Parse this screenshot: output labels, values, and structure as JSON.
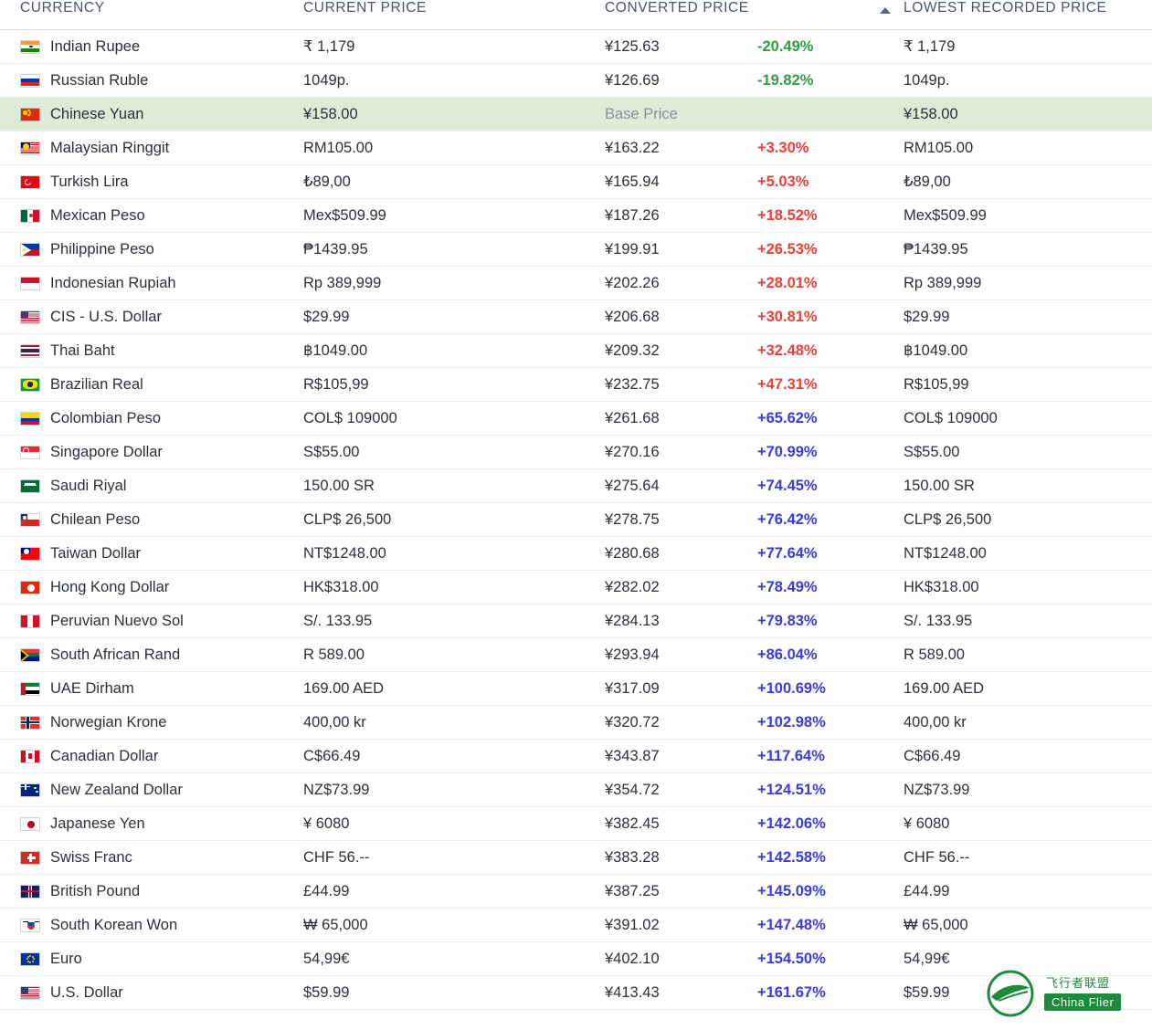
{
  "table": {
    "columns": [
      {
        "key": "currency",
        "label": "CURRENCY"
      },
      {
        "key": "current_price",
        "label": "CURRENT PRICE"
      },
      {
        "key": "converted_price",
        "label": "CONVERTED PRICE"
      },
      {
        "key": "change",
        "label": ""
      },
      {
        "key": "lowest_recorded_price",
        "label": "LOWEST RECORDED PRICE"
      }
    ],
    "sorted_column": "CONVERTED PRICE",
    "sort_direction": "ascending",
    "sort_icon": "triangle-up-icon",
    "base_price_label": "Base Price",
    "colors": {
      "negative": "#2f9e44",
      "positive_red": "#e8413a",
      "positive_blue": "#3b3bd6",
      "base_row_background": "#dcecd7",
      "header_text": "#4a5568"
    },
    "rows": [
      {
        "flag": "flag-india-icon",
        "currency": "Indian Rupee",
        "current": "₹ 1,179",
        "converted": "¥125.63",
        "change": "-20.49%",
        "change_kind": "neg",
        "lowest": "₹ 1,179"
      },
      {
        "flag": "flag-russia-icon",
        "currency": "Russian Ruble",
        "current": "1049р.",
        "converted": "¥126.69",
        "change": "-19.82%",
        "change_kind": "neg",
        "lowest": "1049р."
      },
      {
        "flag": "flag-china-icon",
        "currency": "Chinese Yuan",
        "current": "¥158.00",
        "converted": "Base Price",
        "change": "",
        "change_kind": "base",
        "lowest": "¥158.00"
      },
      {
        "flag": "flag-malaysia-icon",
        "currency": "Malaysian Ringgit",
        "current": "RM105.00",
        "converted": "¥163.22",
        "change": "+3.30%",
        "change_kind": "pos-red",
        "lowest": "RM105.00"
      },
      {
        "flag": "flag-turkey-icon",
        "currency": "Turkish Lira",
        "current": "₺89,00",
        "converted": "¥165.94",
        "change": "+5.03%",
        "change_kind": "pos-red",
        "lowest": "₺89,00"
      },
      {
        "flag": "flag-mexico-icon",
        "currency": "Mexican Peso",
        "current": "Mex$509.99",
        "converted": "¥187.26",
        "change": "+18.52%",
        "change_kind": "pos-red",
        "lowest": "Mex$509.99"
      },
      {
        "flag": "flag-philippines-icon",
        "currency": "Philippine Peso",
        "current": "₱1439.95",
        "converted": "¥199.91",
        "change": "+26.53%",
        "change_kind": "pos-red",
        "lowest": "₱1439.95"
      },
      {
        "flag": "flag-indonesia-icon",
        "currency": "Indonesian Rupiah",
        "current": "Rp 389,999",
        "converted": "¥202.26",
        "change": "+28.01%",
        "change_kind": "pos-red",
        "lowest": "Rp 389,999"
      },
      {
        "flag": "flag-cis-icon",
        "currency": "CIS - U.S. Dollar",
        "current": "$29.99",
        "converted": "¥206.68",
        "change": "+30.81%",
        "change_kind": "pos-red",
        "lowest": "$29.99"
      },
      {
        "flag": "flag-thailand-icon",
        "currency": "Thai Baht",
        "current": "฿1049.00",
        "converted": "¥209.32",
        "change": "+32.48%",
        "change_kind": "pos-red",
        "lowest": "฿1049.00"
      },
      {
        "flag": "flag-brazil-icon",
        "currency": "Brazilian Real",
        "current": "R$105,99",
        "converted": "¥232.75",
        "change": "+47.31%",
        "change_kind": "pos-red",
        "lowest": "R$105,99"
      },
      {
        "flag": "flag-colombia-icon",
        "currency": "Colombian Peso",
        "current": "COL$ 109000",
        "converted": "¥261.68",
        "change": "+65.62%",
        "change_kind": "pos-blue",
        "lowest": "COL$ 109000"
      },
      {
        "flag": "flag-singapore-icon",
        "currency": "Singapore Dollar",
        "current": "S$55.00",
        "converted": "¥270.16",
        "change": "+70.99%",
        "change_kind": "pos-blue",
        "lowest": "S$55.00"
      },
      {
        "flag": "flag-saudi-arabia-icon",
        "currency": "Saudi Riyal",
        "current": "150.00 SR",
        "converted": "¥275.64",
        "change": "+74.45%",
        "change_kind": "pos-blue",
        "lowest": "150.00 SR"
      },
      {
        "flag": "flag-chile-icon",
        "currency": "Chilean Peso",
        "current": "CLP$ 26,500",
        "converted": "¥278.75",
        "change": "+76.42%",
        "change_kind": "pos-blue",
        "lowest": "CLP$ 26,500"
      },
      {
        "flag": "flag-taiwan-icon",
        "currency": "Taiwan Dollar",
        "current": "NT$1248.00",
        "converted": "¥280.68",
        "change": "+77.64%",
        "change_kind": "pos-blue",
        "lowest": "NT$1248.00"
      },
      {
        "flag": "flag-hong-kong-icon",
        "currency": "Hong Kong Dollar",
        "current": "HK$318.00",
        "converted": "¥282.02",
        "change": "+78.49%",
        "change_kind": "pos-blue",
        "lowest": "HK$318.00"
      },
      {
        "flag": "flag-peru-icon",
        "currency": "Peruvian Nuevo Sol",
        "current": "S/. 133.95",
        "converted": "¥284.13",
        "change": "+79.83%",
        "change_kind": "pos-blue",
        "lowest": "S/. 133.95"
      },
      {
        "flag": "flag-south-africa-icon",
        "currency": "South African Rand",
        "current": "R 589.00",
        "converted": "¥293.94",
        "change": "+86.04%",
        "change_kind": "pos-blue",
        "lowest": "R 589.00"
      },
      {
        "flag": "flag-uae-icon",
        "currency": "UAE Dirham",
        "current": "169.00 AED",
        "converted": "¥317.09",
        "change": "+100.69%",
        "change_kind": "pos-blue",
        "lowest": "169.00 AED"
      },
      {
        "flag": "flag-norway-icon",
        "currency": "Norwegian Krone",
        "current": "400,00 kr",
        "converted": "¥320.72",
        "change": "+102.98%",
        "change_kind": "pos-blue",
        "lowest": "400,00 kr"
      },
      {
        "flag": "flag-canada-icon",
        "currency": "Canadian Dollar",
        "current": "C$66.49",
        "converted": "¥343.87",
        "change": "+117.64%",
        "change_kind": "pos-blue",
        "lowest": "C$66.49"
      },
      {
        "flag": "flag-new-zealand-icon",
        "currency": "New Zealand Dollar",
        "current": "NZ$73.99",
        "converted": "¥354.72",
        "change": "+124.51%",
        "change_kind": "pos-blue",
        "lowest": "NZ$73.99"
      },
      {
        "flag": "flag-japan-icon",
        "currency": "Japanese Yen",
        "current": "¥ 6080",
        "converted": "¥382.45",
        "change": "+142.06%",
        "change_kind": "pos-blue",
        "lowest": "¥ 6080"
      },
      {
        "flag": "flag-switzerland-icon",
        "currency": "Swiss Franc",
        "current": "CHF 56.--",
        "converted": "¥383.28",
        "change": "+142.58%",
        "change_kind": "pos-blue",
        "lowest": "CHF 56.--"
      },
      {
        "flag": "flag-united-kingdom-icon",
        "currency": "British Pound",
        "current": "£44.99",
        "converted": "¥387.25",
        "change": "+145.09%",
        "change_kind": "pos-blue",
        "lowest": "£44.99"
      },
      {
        "flag": "flag-south-korea-icon",
        "currency": "South Korean Won",
        "current": "₩ 65,000",
        "converted": "¥391.02",
        "change": "+147.48%",
        "change_kind": "pos-blue",
        "lowest": "₩ 65,000"
      },
      {
        "flag": "flag-european-union-icon",
        "currency": "Euro",
        "current": "54,99€",
        "converted": "¥402.10",
        "change": "+154.50%",
        "change_kind": "pos-blue",
        "lowest": "54,99€"
      },
      {
        "flag": "flag-united-states-icon",
        "currency": "U.S. Dollar",
        "current": "$59.99",
        "converted": "¥413.43",
        "change": "+161.67%",
        "change_kind": "pos-blue",
        "lowest": "$59.99"
      }
    ]
  },
  "watermark": {
    "line1": "飞行者联盟",
    "line2": "China Flier",
    "icon": "flier-logo-icon"
  }
}
